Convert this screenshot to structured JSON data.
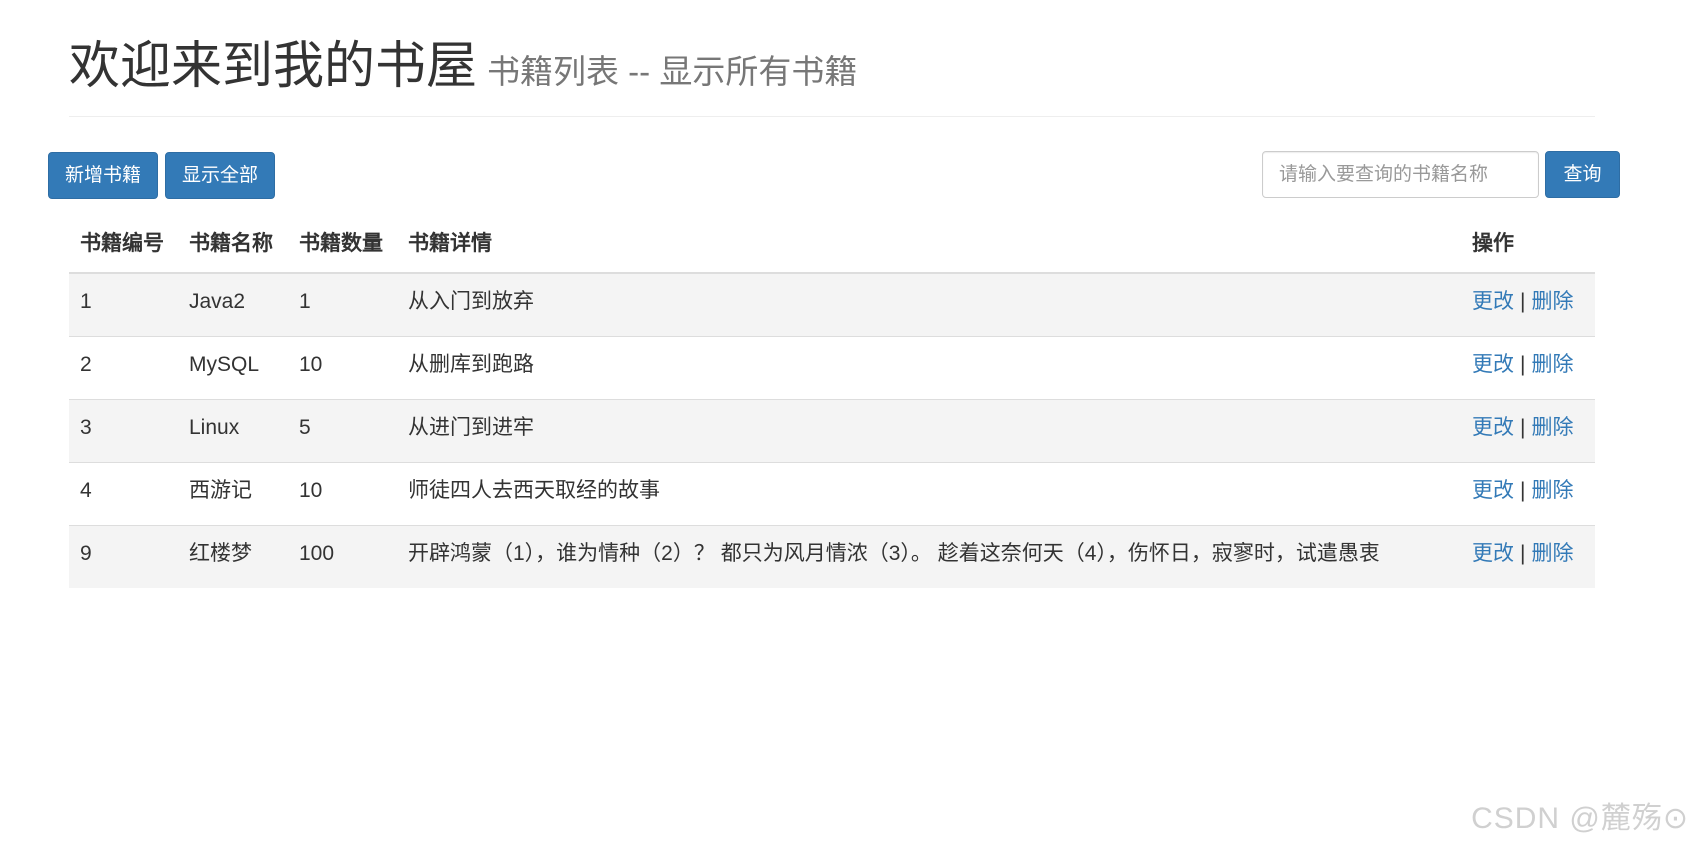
{
  "header": {
    "title": "欢迎来到我的书屋",
    "subtitle": "书籍列表 -- 显示所有书籍"
  },
  "toolbar": {
    "add_label": "新增书籍",
    "show_all_label": "显示全部",
    "search_placeholder": "请输入要查询的书籍名称",
    "search_label": "查询"
  },
  "table": {
    "headers": {
      "id": "书籍编号",
      "name": "书籍名称",
      "count": "书籍数量",
      "detail": "书籍详情",
      "ops": "操作"
    },
    "rows": [
      {
        "id": "1",
        "name": "Java2",
        "count": "1",
        "detail": "从入门到放弃",
        "edit": "更改",
        "sep": "|",
        "delete": "删除"
      },
      {
        "id": "2",
        "name": "MySQL",
        "count": "10",
        "detail": "从删库到跑路",
        "edit": "更改",
        "sep": "|",
        "delete": "删除"
      },
      {
        "id": "3",
        "name": "Linux",
        "count": "5",
        "detail": "从进门到进牢",
        "edit": "更改",
        "sep": "|",
        "delete": "删除"
      },
      {
        "id": "4",
        "name": "西游记",
        "count": "10",
        "detail": "师徒四人去西天取经的故事",
        "edit": "更改",
        "sep": "|",
        "delete": "删除"
      },
      {
        "id": "9",
        "name": "红楼梦",
        "count": "100",
        "detail": "开辟鸿蒙（1），谁为情种（2）？ 都只为风月情浓（3）。 趁着这奈何天（4），伤怀日，寂寥时，试遣愚衷",
        "edit": "更改",
        "sep": "|",
        "delete": "删除"
      }
    ]
  },
  "watermark": "CSDN @麓殇⊙"
}
